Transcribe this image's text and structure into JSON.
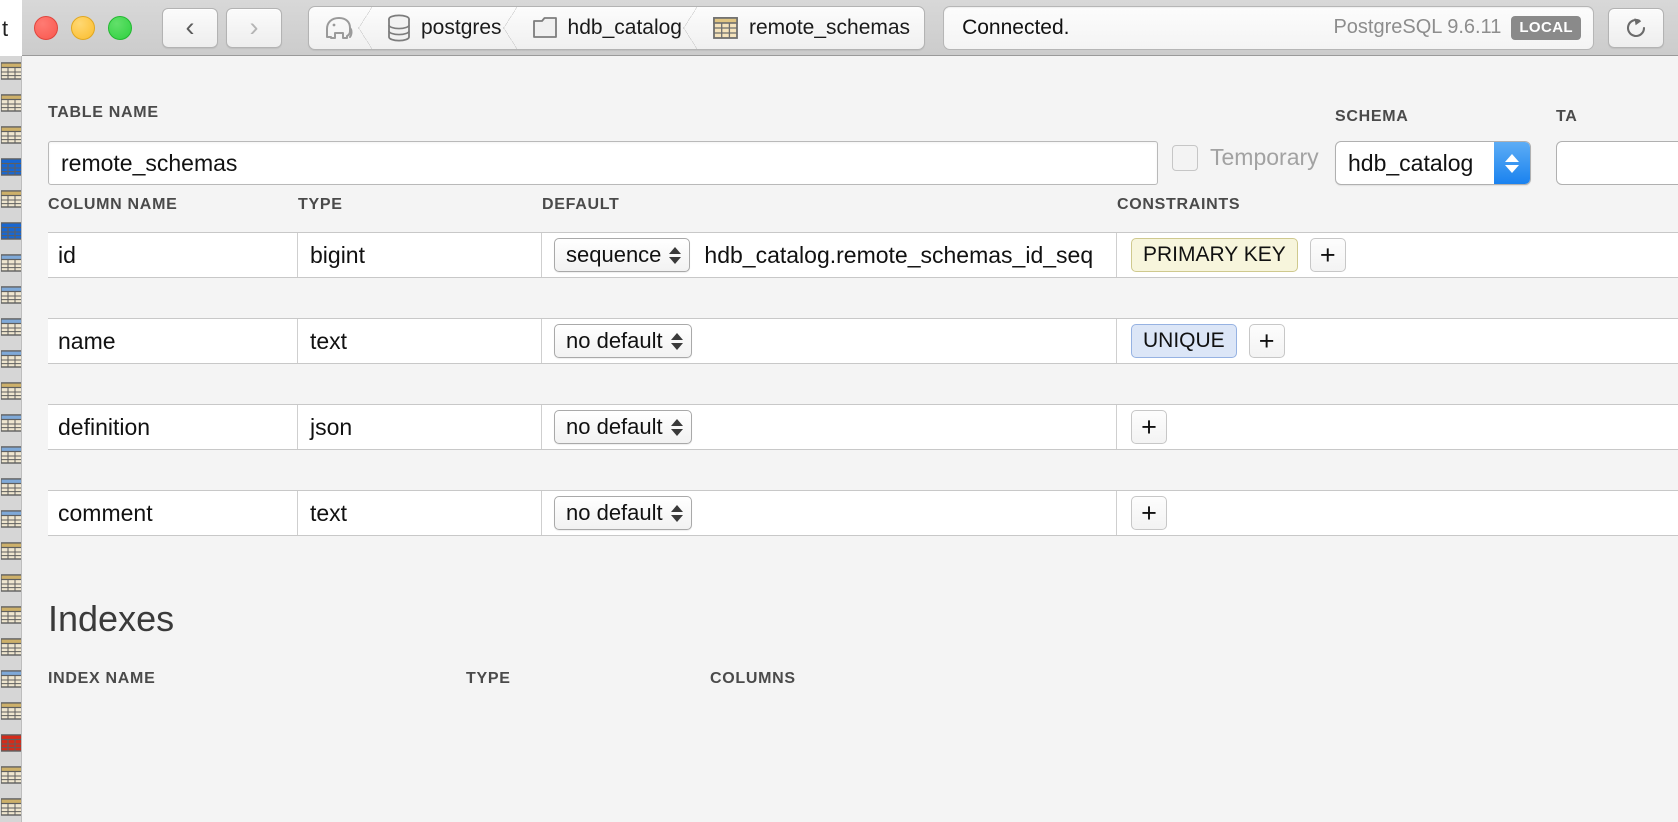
{
  "window": {
    "traffic_lights": [
      "close",
      "minimize",
      "zoom"
    ],
    "nav": {
      "back": "back-chevron",
      "forward": "forward-chevron"
    }
  },
  "breadcrumb": {
    "items": [
      {
        "icon": "elephant-icon",
        "label": ""
      },
      {
        "icon": "database-icon",
        "label": "postgres"
      },
      {
        "icon": "folder-icon",
        "label": "hdb_catalog"
      },
      {
        "icon": "table-grid-icon",
        "label": "remote_schemas"
      }
    ]
  },
  "status": {
    "text": "Connected.",
    "server_version": "PostgreSQL 9.6.11",
    "badge": "LOCAL",
    "refresh_icon": "refresh-icon"
  },
  "form": {
    "table_name_label": "TABLE NAME",
    "table_name_value": "remote_schemas",
    "temporary_label": "Temporary",
    "temporary_checked": false,
    "schema_label": "SCHEMA",
    "schema_value": "hdb_catalog",
    "tablespace_label": "TA"
  },
  "columns": {
    "headers": {
      "name": "COLUMN NAME",
      "type": "TYPE",
      "default": "DEFAULT",
      "constraints": "CONSTRAINTS"
    },
    "rows": [
      {
        "name": "id",
        "type": "bigint",
        "default_mode": "sequence",
        "default_detail": "hdb_catalog.remote_schemas_id_seq",
        "constraint": "PRIMARY KEY",
        "constraint_style": "pk",
        "add_label": "+"
      },
      {
        "name": "name",
        "type": "text",
        "default_mode": "no default",
        "default_detail": "",
        "constraint": "UNIQUE",
        "constraint_style": "uq",
        "add_label": "+"
      },
      {
        "name": "definition",
        "type": "json",
        "default_mode": "no default",
        "default_detail": "",
        "constraint": "",
        "constraint_style": "none",
        "add_label": "+"
      },
      {
        "name": "comment",
        "type": "text",
        "default_mode": "no default",
        "default_detail": "",
        "constraint": "",
        "constraint_style": "none",
        "add_label": "+"
      }
    ]
  },
  "indexes": {
    "title": "Indexes",
    "headers": {
      "name": "INDEX NAME",
      "type": "TYPE",
      "columns": "COLUMNS"
    },
    "rows": []
  },
  "colors": {
    "accent_blue": "#1a82ef",
    "pk_bg": "#f7f5dc",
    "uq_bg": "#dce6f7",
    "badge_gray": "#8a8a8a"
  }
}
